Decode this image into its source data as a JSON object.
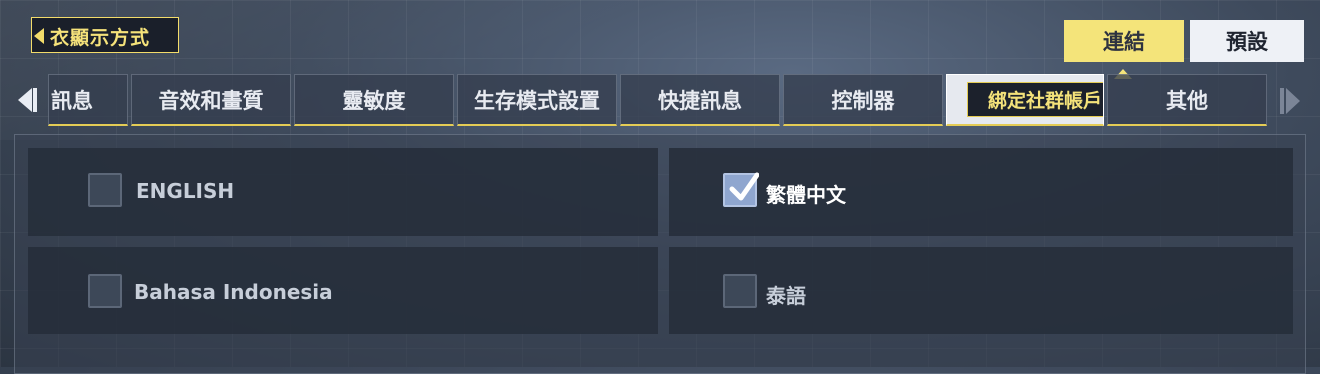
{
  "header": {
    "back_label": "衣顯示方式"
  },
  "preset_toggle": {
    "connect_label": "連結",
    "default_label": "預設",
    "selected": "連結"
  },
  "tabs": [
    {
      "label": "訊息",
      "active": false
    },
    {
      "label": "音效和畫質",
      "active": false
    },
    {
      "label": "靈敏度",
      "active": false
    },
    {
      "label": "生存模式設置",
      "active": false
    },
    {
      "label": "快捷訊息",
      "active": false
    },
    {
      "label": "控制器",
      "active": false
    },
    {
      "label": "綁定社群帳戶",
      "active": true
    },
    {
      "label": "其他",
      "active": false
    }
  ],
  "languages": [
    {
      "label": "ENGLISH",
      "checked": false
    },
    {
      "label": "繁體中文",
      "checked": true
    },
    {
      "label": "Bahasa Indonesia",
      "checked": false
    },
    {
      "label": "泰語",
      "checked": false
    }
  ],
  "colors": {
    "accent": "#f4e47a",
    "tab_underline": "#e4cc55",
    "checkbox_checked": "#8fa6cf"
  }
}
